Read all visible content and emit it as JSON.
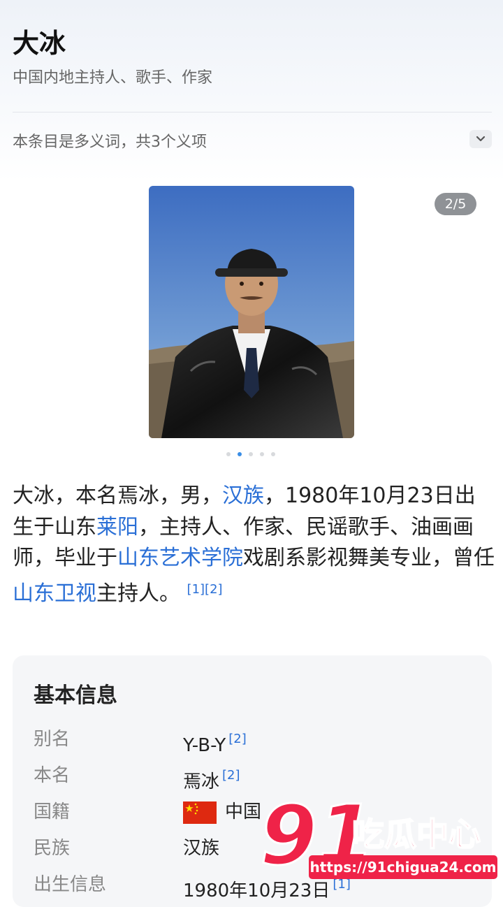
{
  "article": {
    "title": "大冰",
    "subtitle": "中国内地主持人、歌手、作家",
    "polysemy_note": "本条目是多义词，共3个义项"
  },
  "gallery": {
    "counter": "2/5",
    "current_index": 2,
    "total": 5
  },
  "intro": {
    "p1": "大冰，本名焉冰，男，",
    "link_hanzu": "汉族",
    "p2": "，1980年10月23日出生于山东",
    "link_laiyang": "莱阳",
    "p3": "，主持人、作家、民谣歌手、油画画师，毕业于",
    "link_academy": "山东艺术学院",
    "p4": "戏剧系影视舞美专业，曾任",
    "link_tv": "山东卫视",
    "p5": "主持人。",
    "ref1": "[1]",
    "ref2": "[2]"
  },
  "info": {
    "heading": "基本信息",
    "rows": [
      {
        "label": "别名",
        "value": "Y-B-Y",
        "ref": "[2]"
      },
      {
        "label": "本名",
        "value": "焉冰",
        "ref": "[2]"
      },
      {
        "label": "国籍",
        "value": "中国",
        "ref": ""
      },
      {
        "label": "民族",
        "value": "汉族",
        "ref": ""
      },
      {
        "label": "出生信息",
        "value": "1980年10月23日",
        "ref": "[1]"
      }
    ]
  },
  "watermark": {
    "number": "91",
    "name": "吃瓜中心",
    "url": "https://91chigua24.com"
  },
  "colors": {
    "link": "#2a6fd6",
    "watermark_red": "#ef2348"
  }
}
